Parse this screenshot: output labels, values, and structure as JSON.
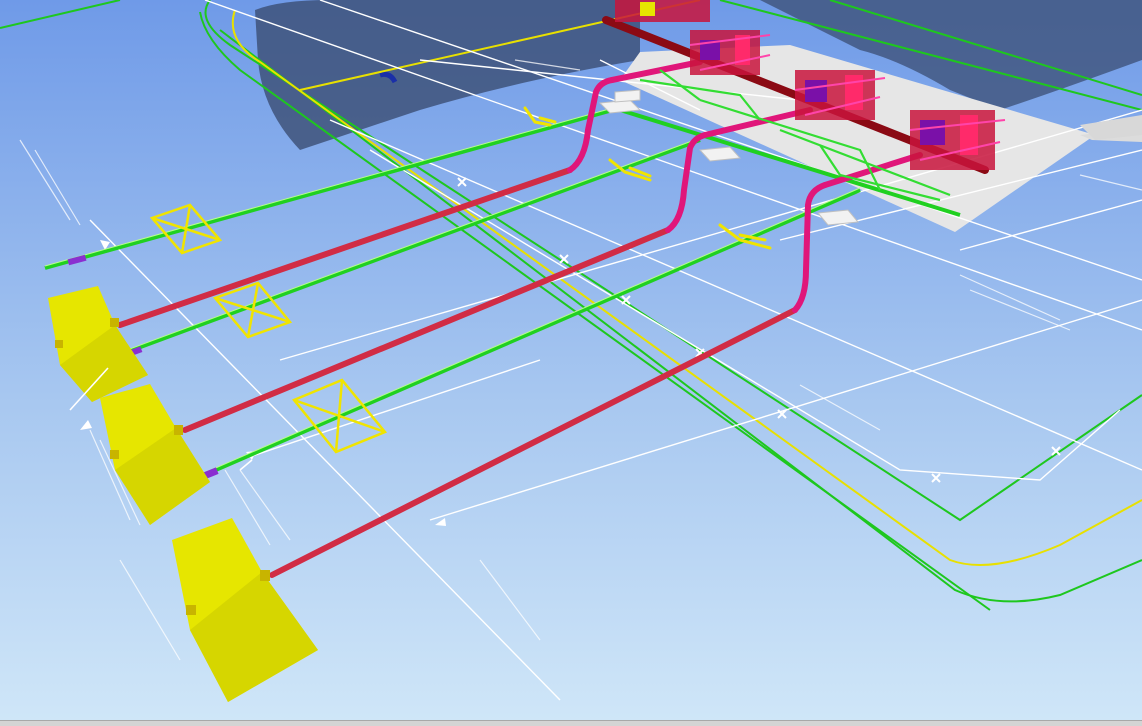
{
  "viewport": {
    "type": "3D plant piping model view",
    "background_gradient": [
      "#6f9ae8",
      "#cfe6f8"
    ],
    "colors": {
      "main_pipe": "#d12c45",
      "pipe_riser": "#e0167a",
      "header_pipe": "#8b0a14",
      "green_pipe": "#20d020",
      "green_line": "#1ec71e",
      "yellow_line": "#e8e000",
      "dimension_line": "#ffffff",
      "equipment_block": "#e6e600",
      "platform": "#e6e6e6",
      "cooler_shadow": "#3b4d73"
    },
    "equipment_count": 3,
    "main_pipe_runs": 3,
    "green_pipe_runs": 4,
    "icons": [
      "equipment-block",
      "valve",
      "x-marker",
      "support-bracket",
      "dimension-arrow"
    ]
  },
  "status_strip": {}
}
